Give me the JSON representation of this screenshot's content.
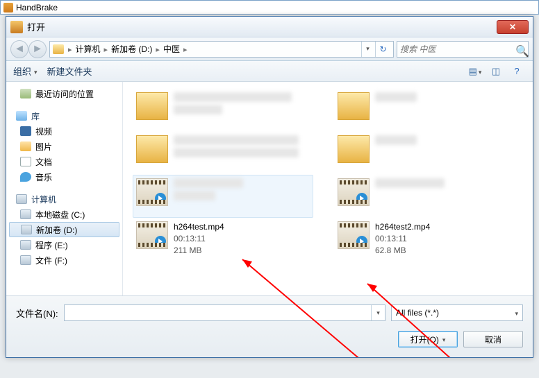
{
  "app": {
    "title": "HandBrake"
  },
  "dialog": {
    "title": "打开"
  },
  "breadcrumb": {
    "items": [
      "计算机",
      "新加卷 (D:)",
      "中医"
    ]
  },
  "search": {
    "placeholder": "搜索 中医"
  },
  "toolbar": {
    "organize": "组织",
    "newfolder": "新建文件夹"
  },
  "tree": {
    "recent": "最近访问的位置",
    "libs_header": "库",
    "libs": {
      "video": "视频",
      "pictures": "图片",
      "docs": "文档",
      "music": "音乐"
    },
    "computer_header": "计算机",
    "drives": {
      "c": "本地磁盘 (C:)",
      "d": "新加卷 (D:)",
      "e": "程序 (E:)",
      "f": "文件 (F:)"
    }
  },
  "files": {
    "item5": {
      "name": "h264test.mp4",
      "duration": "00:13:11",
      "size": "211 MB"
    },
    "item6": {
      "name": "h264test2.mp4",
      "duration": "00:13:11",
      "size": "62.8 MB"
    }
  },
  "bottom": {
    "filename_label": "文件名(N):",
    "filename_value": "",
    "filter": "All files (*.*)",
    "open": "打开(O)",
    "cancel": "取消"
  }
}
